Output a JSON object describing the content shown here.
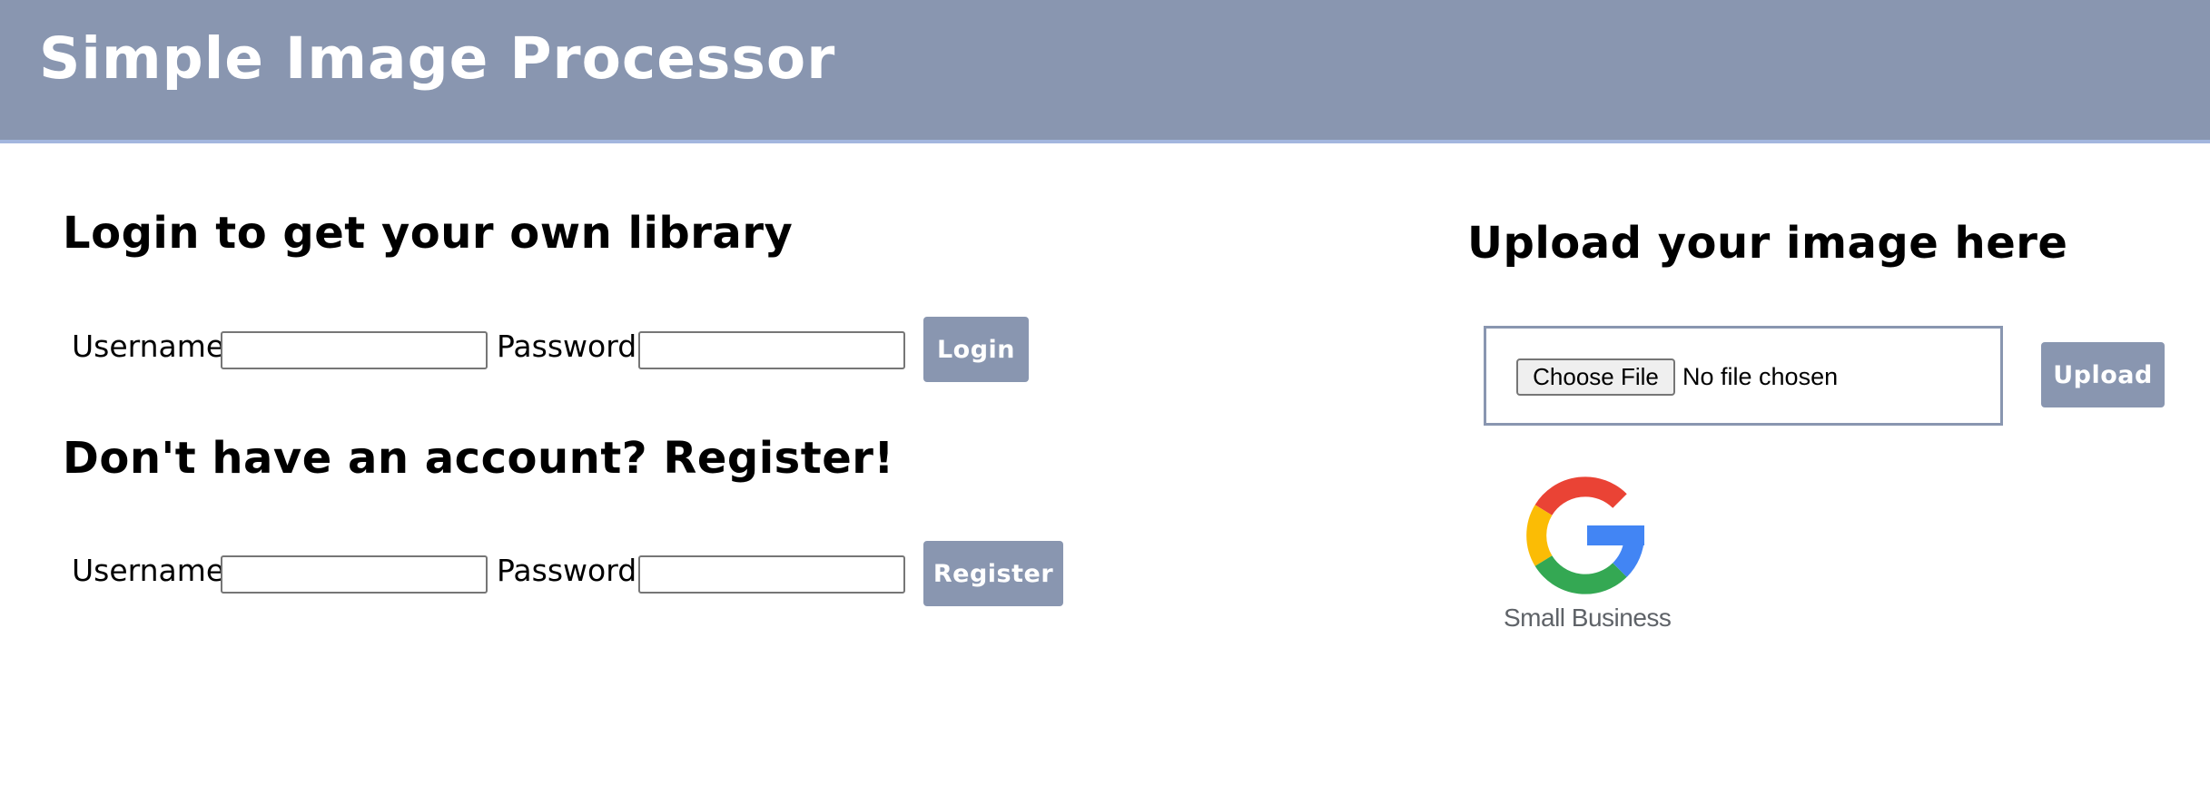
{
  "header": {
    "title": "Simple Image Processor"
  },
  "login": {
    "heading": "Login to get your own library",
    "username_label": "Username",
    "username_value": "",
    "password_label": "Password",
    "password_value": "",
    "button_label": "Login"
  },
  "register": {
    "heading": "Don't have an account? Register!",
    "username_label": "Username",
    "username_value": "",
    "password_label": "Password",
    "password_value": "",
    "button_label": "Register"
  },
  "upload": {
    "heading": "Upload your image here",
    "choose_file_label": "Choose File",
    "no_file_text": "No file chosen",
    "button_label": "Upload"
  },
  "logo": {
    "icon": "google-g-logo",
    "caption": "Small Business"
  },
  "colors": {
    "accent": "#8996b0",
    "header_border": "#a3b6de",
    "google_red": "#ea4335",
    "google_yellow": "#fbbc05",
    "google_green": "#34a853",
    "google_blue": "#4285f4"
  }
}
